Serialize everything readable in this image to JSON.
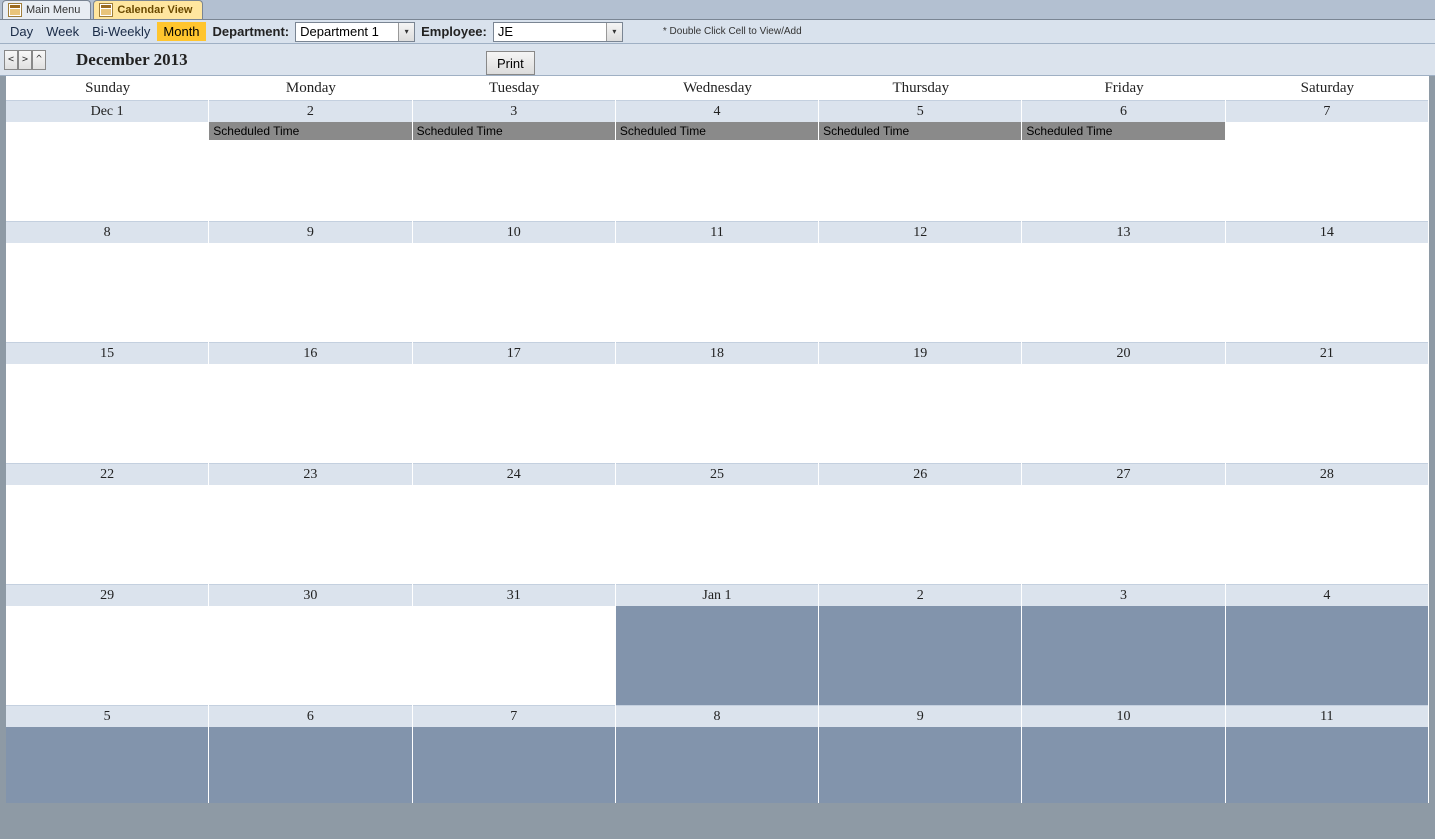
{
  "tabs": [
    {
      "label": "Main Menu",
      "active": false
    },
    {
      "label": "Calendar View",
      "active": true
    }
  ],
  "views": {
    "day": "Day",
    "week": "Week",
    "biweekly": "Bi-Weekly",
    "month": "Month",
    "active": "month"
  },
  "filters": {
    "department_label": "Department:",
    "department_value": "Department 1",
    "employee_label": "Employee:",
    "employee_value": "JE"
  },
  "help_text": "* Double Click Cell to View/Add",
  "nav": {
    "prev": "<",
    "next": ">",
    "up": "^",
    "title": "December 2013",
    "print": "Print"
  },
  "day_names": [
    "Sunday",
    "Monday",
    "Tuesday",
    "Wednesday",
    "Thursday",
    "Friday",
    "Saturday"
  ],
  "event_label": "Scheduled Time",
  "weeks": [
    {
      "days": [
        {
          "label": "Dec 1",
          "next_month": false,
          "events": []
        },
        {
          "label": "2",
          "next_month": false,
          "events": [
            "Scheduled Time"
          ]
        },
        {
          "label": "3",
          "next_month": false,
          "events": [
            "Scheduled Time"
          ]
        },
        {
          "label": "4",
          "next_month": false,
          "events": [
            "Scheduled Time"
          ]
        },
        {
          "label": "5",
          "next_month": false,
          "events": [
            "Scheduled Time"
          ]
        },
        {
          "label": "6",
          "next_month": false,
          "events": [
            "Scheduled Time"
          ]
        },
        {
          "label": "7",
          "next_month": false,
          "events": []
        }
      ]
    },
    {
      "days": [
        {
          "label": "8",
          "next_month": false,
          "events": []
        },
        {
          "label": "9",
          "next_month": false,
          "events": []
        },
        {
          "label": "10",
          "next_month": false,
          "events": []
        },
        {
          "label": "11",
          "next_month": false,
          "events": []
        },
        {
          "label": "12",
          "next_month": false,
          "events": []
        },
        {
          "label": "13",
          "next_month": false,
          "events": []
        },
        {
          "label": "14",
          "next_month": false,
          "events": []
        }
      ]
    },
    {
      "days": [
        {
          "label": "15",
          "next_month": false,
          "events": []
        },
        {
          "label": "16",
          "next_month": false,
          "events": []
        },
        {
          "label": "17",
          "next_month": false,
          "events": []
        },
        {
          "label": "18",
          "next_month": false,
          "events": []
        },
        {
          "label": "19",
          "next_month": false,
          "events": []
        },
        {
          "label": "20",
          "next_month": false,
          "events": []
        },
        {
          "label": "21",
          "next_month": false,
          "events": []
        }
      ]
    },
    {
      "days": [
        {
          "label": "22",
          "next_month": false,
          "events": []
        },
        {
          "label": "23",
          "next_month": false,
          "events": []
        },
        {
          "label": "24",
          "next_month": false,
          "events": []
        },
        {
          "label": "25",
          "next_month": false,
          "events": []
        },
        {
          "label": "26",
          "next_month": false,
          "events": []
        },
        {
          "label": "27",
          "next_month": false,
          "events": []
        },
        {
          "label": "28",
          "next_month": false,
          "events": []
        }
      ]
    },
    {
      "days": [
        {
          "label": "29",
          "next_month": false,
          "events": []
        },
        {
          "label": "30",
          "next_month": false,
          "events": []
        },
        {
          "label": "31",
          "next_month": false,
          "events": []
        },
        {
          "label": "Jan 1",
          "next_month": true,
          "events": []
        },
        {
          "label": "2",
          "next_month": true,
          "events": []
        },
        {
          "label": "3",
          "next_month": true,
          "events": []
        },
        {
          "label": "4",
          "next_month": true,
          "events": []
        }
      ]
    },
    {
      "last": true,
      "days": [
        {
          "label": "5",
          "next_month": true,
          "events": []
        },
        {
          "label": "6",
          "next_month": true,
          "events": []
        },
        {
          "label": "7",
          "next_month": true,
          "events": []
        },
        {
          "label": "8",
          "next_month": true,
          "events": []
        },
        {
          "label": "9",
          "next_month": true,
          "events": []
        },
        {
          "label": "10",
          "next_month": true,
          "events": []
        },
        {
          "label": "11",
          "next_month": true,
          "events": []
        }
      ]
    }
  ]
}
